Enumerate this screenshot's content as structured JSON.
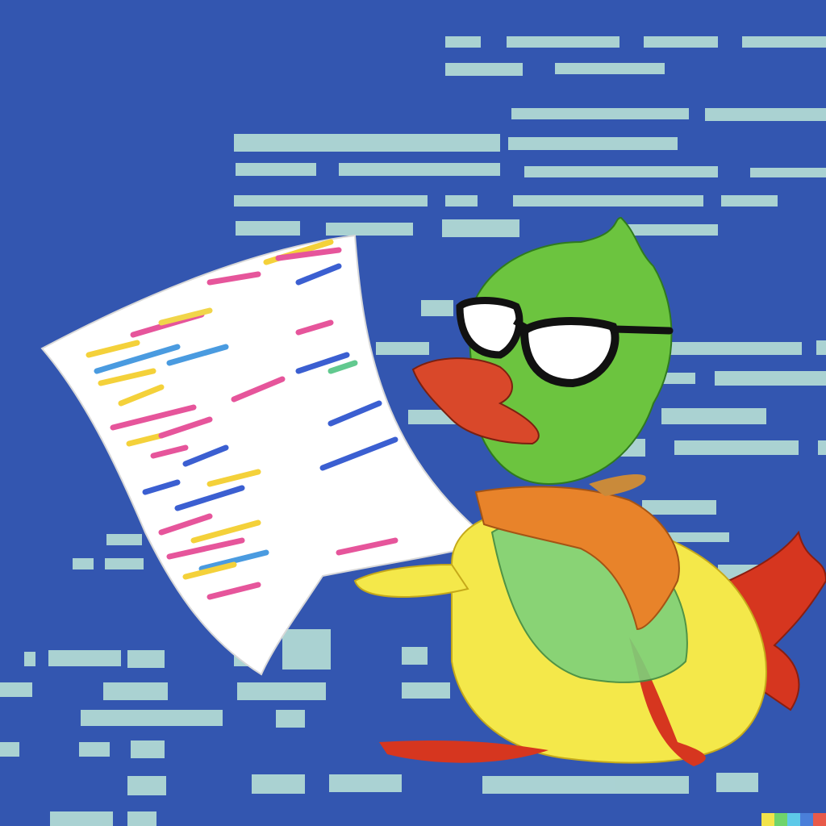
{
  "colors": {
    "background": "#3356b0",
    "glyph": "#bfe8d9",
    "paper": "#ffffff",
    "duck_head": "#6cc43f",
    "duck_body": "#f4e84a",
    "beak": "#d9482a",
    "scarf": "#e8832a",
    "wing": "#d6361f",
    "glasses": "#111111"
  },
  "icons": {
    "duck": "cartoon-duck-with-glasses",
    "document": "code-printout-sheet"
  },
  "watermark": {
    "colors": [
      "#f2e34a",
      "#6fd46b",
      "#5dc9e8",
      "#4a7fd9",
      "#e85a4a"
    ]
  }
}
